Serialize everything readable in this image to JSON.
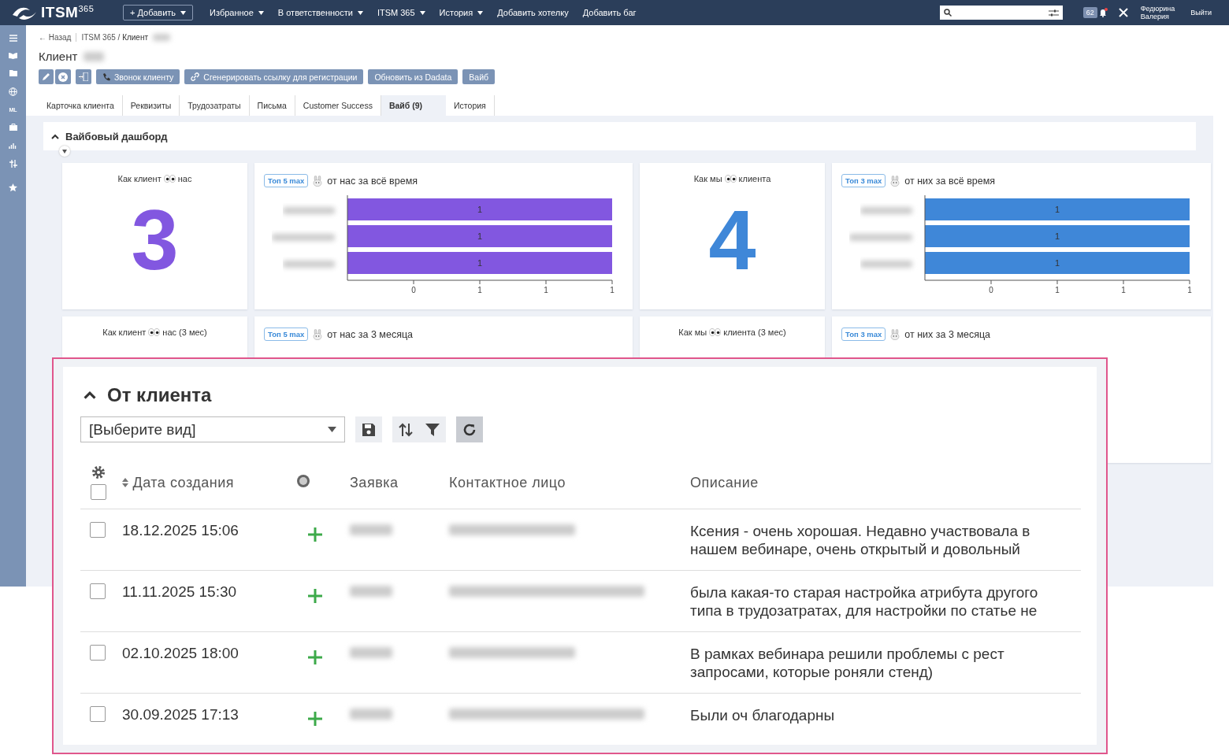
{
  "topbar": {
    "logo": "ITSM",
    "logo_sup": "365",
    "add_button": "+ Добавить",
    "menu": [
      {
        "label": "Избранное",
        "dropdown": true
      },
      {
        "label": "В ответственности",
        "dropdown": true
      },
      {
        "label": "ITSM 365",
        "dropdown": true
      },
      {
        "label": "История",
        "dropdown": true
      },
      {
        "label": "Добавить хотелку",
        "dropdown": false
      },
      {
        "label": "Добавить баг",
        "dropdown": false
      }
    ],
    "notifications": "62",
    "user": [
      "Федюрина",
      "Валерия"
    ],
    "logout": "Выйти"
  },
  "sidebar": {
    "ml_label": "ML"
  },
  "breadcrumb": {
    "back": "← Назад",
    "path": "ITSM 365 / ",
    "current": "Клиент"
  },
  "page_title": "Клиент",
  "actions": [
    "Звонок клиенту",
    "Сгенерировать ссылку для регистрации",
    "Обновить из Dadata",
    "Вайб"
  ],
  "tabs": [
    {
      "label": "Карточка клиента",
      "selected": false
    },
    {
      "label": "Реквизиты",
      "selected": false
    },
    {
      "label": "Трудозатраты",
      "selected": false
    },
    {
      "label": "Письма",
      "selected": false
    },
    {
      "label": "Customer Success",
      "selected": false
    },
    {
      "label": "Вайб (9)",
      "selected": true
    },
    {
      "label": "История",
      "selected": false
    }
  ],
  "dashboard": {
    "title": "Вайбовый дашборд",
    "expanded": true,
    "cards": [
      {
        "kind": "number",
        "title_before": "Как клиент",
        "title_after": "нас",
        "value": "3",
        "color": "#8257e0"
      },
      {
        "kind": "chart",
        "badge": "Топ 5 max",
        "title": "от нас за всё время",
        "color": "#8257e0",
        "chart_data": {
          "type": "bar",
          "orientation": "horizontal",
          "values": [
            1,
            1,
            1
          ],
          "xlim": [
            0,
            1
          ],
          "xticks": [
            {
              "value": 0.25,
              "label": "0"
            },
            {
              "value": 0.5,
              "label": "1"
            },
            {
              "value": 0.75,
              "label": "1"
            },
            {
              "value": 1,
              "label": "1"
            }
          ],
          "data_labels": true
        }
      },
      {
        "kind": "number",
        "title_before": "Как мы",
        "title_after": "клиента",
        "value": "4",
        "color": "#3f87d8"
      },
      {
        "kind": "chart",
        "badge": "Топ 3 max",
        "title": "от них за всё время",
        "color": "#3f87d8",
        "chart_data": {
          "type": "bar",
          "orientation": "horizontal",
          "values": [
            1,
            1,
            1
          ],
          "xlim": [
            0,
            1
          ],
          "xticks": [
            {
              "value": 0.25,
              "label": "0"
            },
            {
              "value": 0.5,
              "label": "1"
            },
            {
              "value": 0.75,
              "label": "1"
            },
            {
              "value": 1,
              "label": "1"
            }
          ],
          "data_labels": true
        }
      },
      {
        "kind": "number",
        "title_before": "Как клиент",
        "title_after": "нас (3 мес)"
      },
      {
        "kind": "chart",
        "badge": "Топ 5 max",
        "title": "от нас за 3 месяца"
      },
      {
        "kind": "number",
        "title_before": "Как мы",
        "title_after": "клиента (3 мес)"
      },
      {
        "kind": "chart",
        "badge": "Топ 3 max",
        "title": "от них за 3 месяца"
      }
    ]
  },
  "panel": {
    "title": "От клиента",
    "expanded": true,
    "view_select": "[Выберите вид]",
    "columns": [
      "Дата создания",
      "Заявка",
      "Контактное лицо",
      "Описание"
    ],
    "select_all": {
      "checked": false
    },
    "rows": [
      {
        "checked": false,
        "date": "18.12.2025 15:06",
        "description": "Ксения - очень хорошая. Недавно участвовала в нашем вебинаре, очень открытый и довольный"
      },
      {
        "checked": false,
        "date": "11.11.2025 15:30",
        "description": "была какая-то старая настройка атрибута другого типа в трудозатратах, для настройки по статье не"
      },
      {
        "checked": false,
        "date": "02.10.2025 18:00",
        "description": "В рамках вебинара решили проблемы с рест запросами, которые роняли стенд)"
      },
      {
        "checked": false,
        "date": "30.09.2025 17:13",
        "description": "Были оч благодарны"
      }
    ]
  }
}
